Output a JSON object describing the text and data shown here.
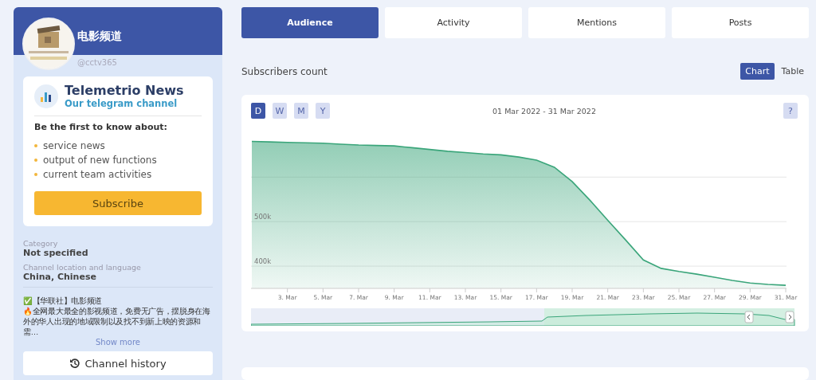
{
  "channel": {
    "title": "电影频道",
    "handle": "@cctv365"
  },
  "promo": {
    "title": "Telemetrio News",
    "subtitle": "Our telegram channel",
    "lead": "Be the first to know about:",
    "items": [
      "service news",
      "output of new functions",
      "current team activities"
    ],
    "button": "Subscribe"
  },
  "info": [
    {
      "label": "Category",
      "value": "Not specified"
    },
    {
      "label": "Channel location and language",
      "value": "China, Chinese"
    }
  ],
  "description": {
    "text": "✅【华联社】电影频道\n🔥全网最大最全的影视频道，免费无广告，摆脱身在海外的华人出现的地域限制以及找不到新上映的资源和需…",
    "more": "Show more"
  },
  "history_button": "Channel history",
  "tabs": [
    {
      "label": "Audience",
      "selected": true
    },
    {
      "label": "Activity",
      "selected": false
    },
    {
      "label": "Mentions",
      "selected": false
    },
    {
      "label": "Posts",
      "selected": false
    }
  ],
  "section_title": "Subscribers count",
  "view_toggle": [
    {
      "label": "Chart",
      "selected": true
    },
    {
      "label": "Table",
      "selected": false
    }
  ],
  "chart": {
    "periods": [
      {
        "label": "D",
        "selected": true
      },
      {
        "label": "W",
        "selected": false
      },
      {
        "label": "M",
        "selected": false
      },
      {
        "label": "Y",
        "selected": false
      }
    ],
    "date_range": "01 Mar 2022 - 31 Mar 2022",
    "help": "?",
    "chart_data": {
      "type": "area",
      "categories": [
        null,
        null,
        "3. Mar",
        null,
        "5. Mar",
        null,
        "7. Mar",
        null,
        "9. Mar",
        null,
        "11. Mar",
        null,
        "13. Mar",
        null,
        "15. Mar",
        null,
        "17. Mar",
        null,
        "19. Mar",
        null,
        "21. Mar",
        null,
        "23. Mar",
        null,
        "25. Mar",
        null,
        "27. Mar",
        null,
        "29. Mar",
        null,
        "31. Mar"
      ],
      "series": [
        {
          "color": "#3aa57a",
          "values": [
            680000,
            679000,
            678000,
            677000,
            676000,
            674000,
            672000,
            671000,
            670000,
            666000,
            662000,
            658000,
            655000,
            652000,
            650000,
            645000,
            638000,
            622000,
            590000,
            548000,
            503000,
            459000,
            414000,
            395000,
            388000,
            382000,
            375000,
            368000,
            362000,
            359000,
            357000
          ]
        }
      ],
      "ylim": [
        253400,
        784800
      ],
      "yticks": [
        {
          "value": 400000,
          "label": "400k"
        },
        {
          "value": 500000,
          "label": "500k"
        }
      ]
    }
  }
}
